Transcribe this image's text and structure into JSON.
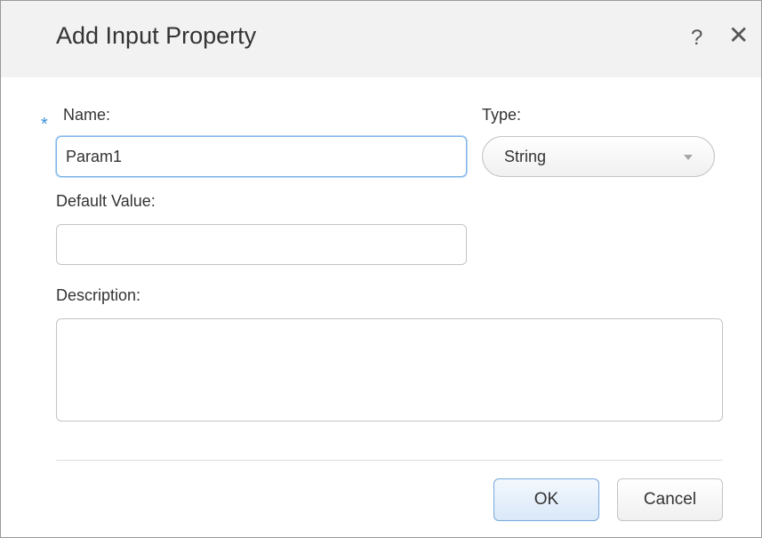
{
  "dialog": {
    "title": "Add Input Property",
    "help_icon": "?",
    "close_icon": "✕"
  },
  "form": {
    "required_marker": "*",
    "name_label": "Name:",
    "name_value": "Param1",
    "type_label": "Type:",
    "type_value": "String",
    "default_value_label": "Default Value:",
    "default_value_value": "",
    "description_label": "Description:",
    "description_value": ""
  },
  "buttons": {
    "ok_label": "OK",
    "cancel_label": "Cancel"
  },
  "colors": {
    "required_marker": "#3b8fd9",
    "focus_border": "#7eb4ea",
    "primary_button_border": "#76a8de"
  }
}
